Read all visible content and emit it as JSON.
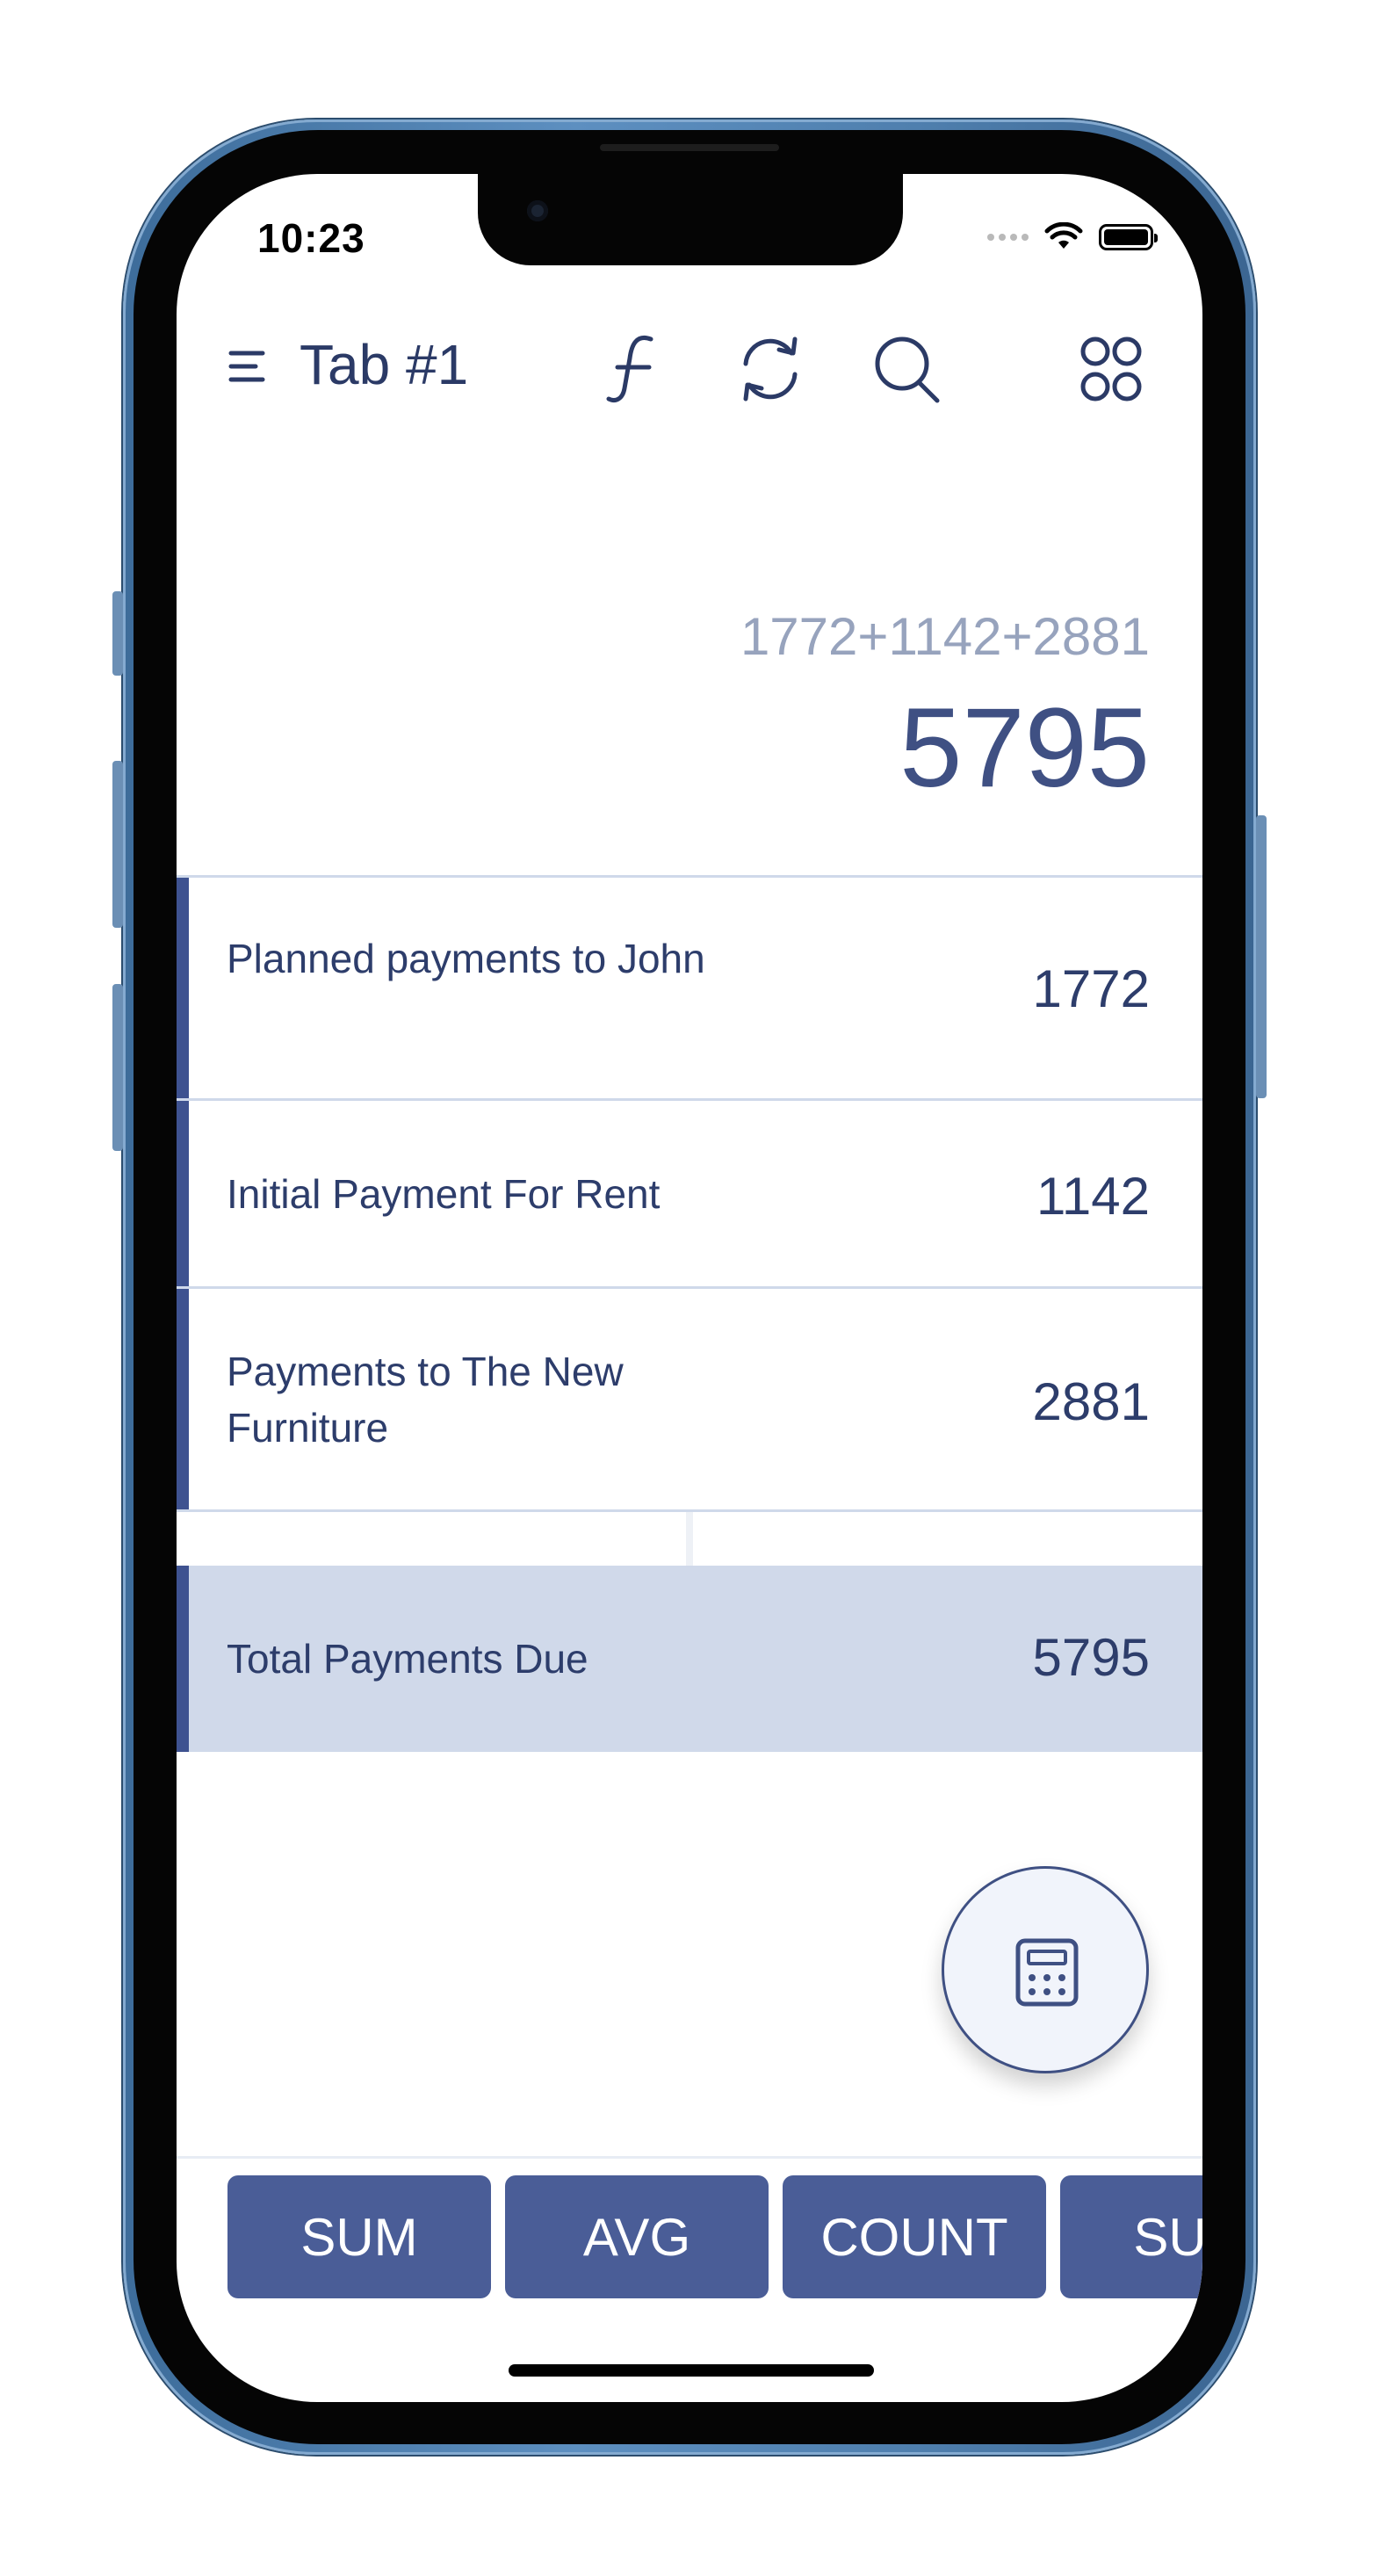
{
  "status_bar": {
    "time": "10:23"
  },
  "toolbar": {
    "tab_title": "Tab #1",
    "icons": [
      "menu-icon",
      "function-icon",
      "refresh-icon",
      "search-icon",
      "apps-grid-icon"
    ]
  },
  "display": {
    "expression": "1772+1142+2881",
    "result": "5795"
  },
  "rows": [
    {
      "label": "Planned payments to John",
      "value": "1772"
    },
    {
      "label": "Initial Payment For Rent",
      "value": "1142"
    },
    {
      "label": "Payments to The New Furniture",
      "value": "2881"
    }
  ],
  "total": {
    "label": "Total Payments Due",
    "value": "5795"
  },
  "function_buttons": [
    "SUM",
    "AVG",
    "COUNT",
    "SUM"
  ],
  "colors": {
    "accent": "#3e5290",
    "button": "#4a5d97",
    "total_background": "#d0d9ea",
    "text": "#2d3d6b"
  }
}
